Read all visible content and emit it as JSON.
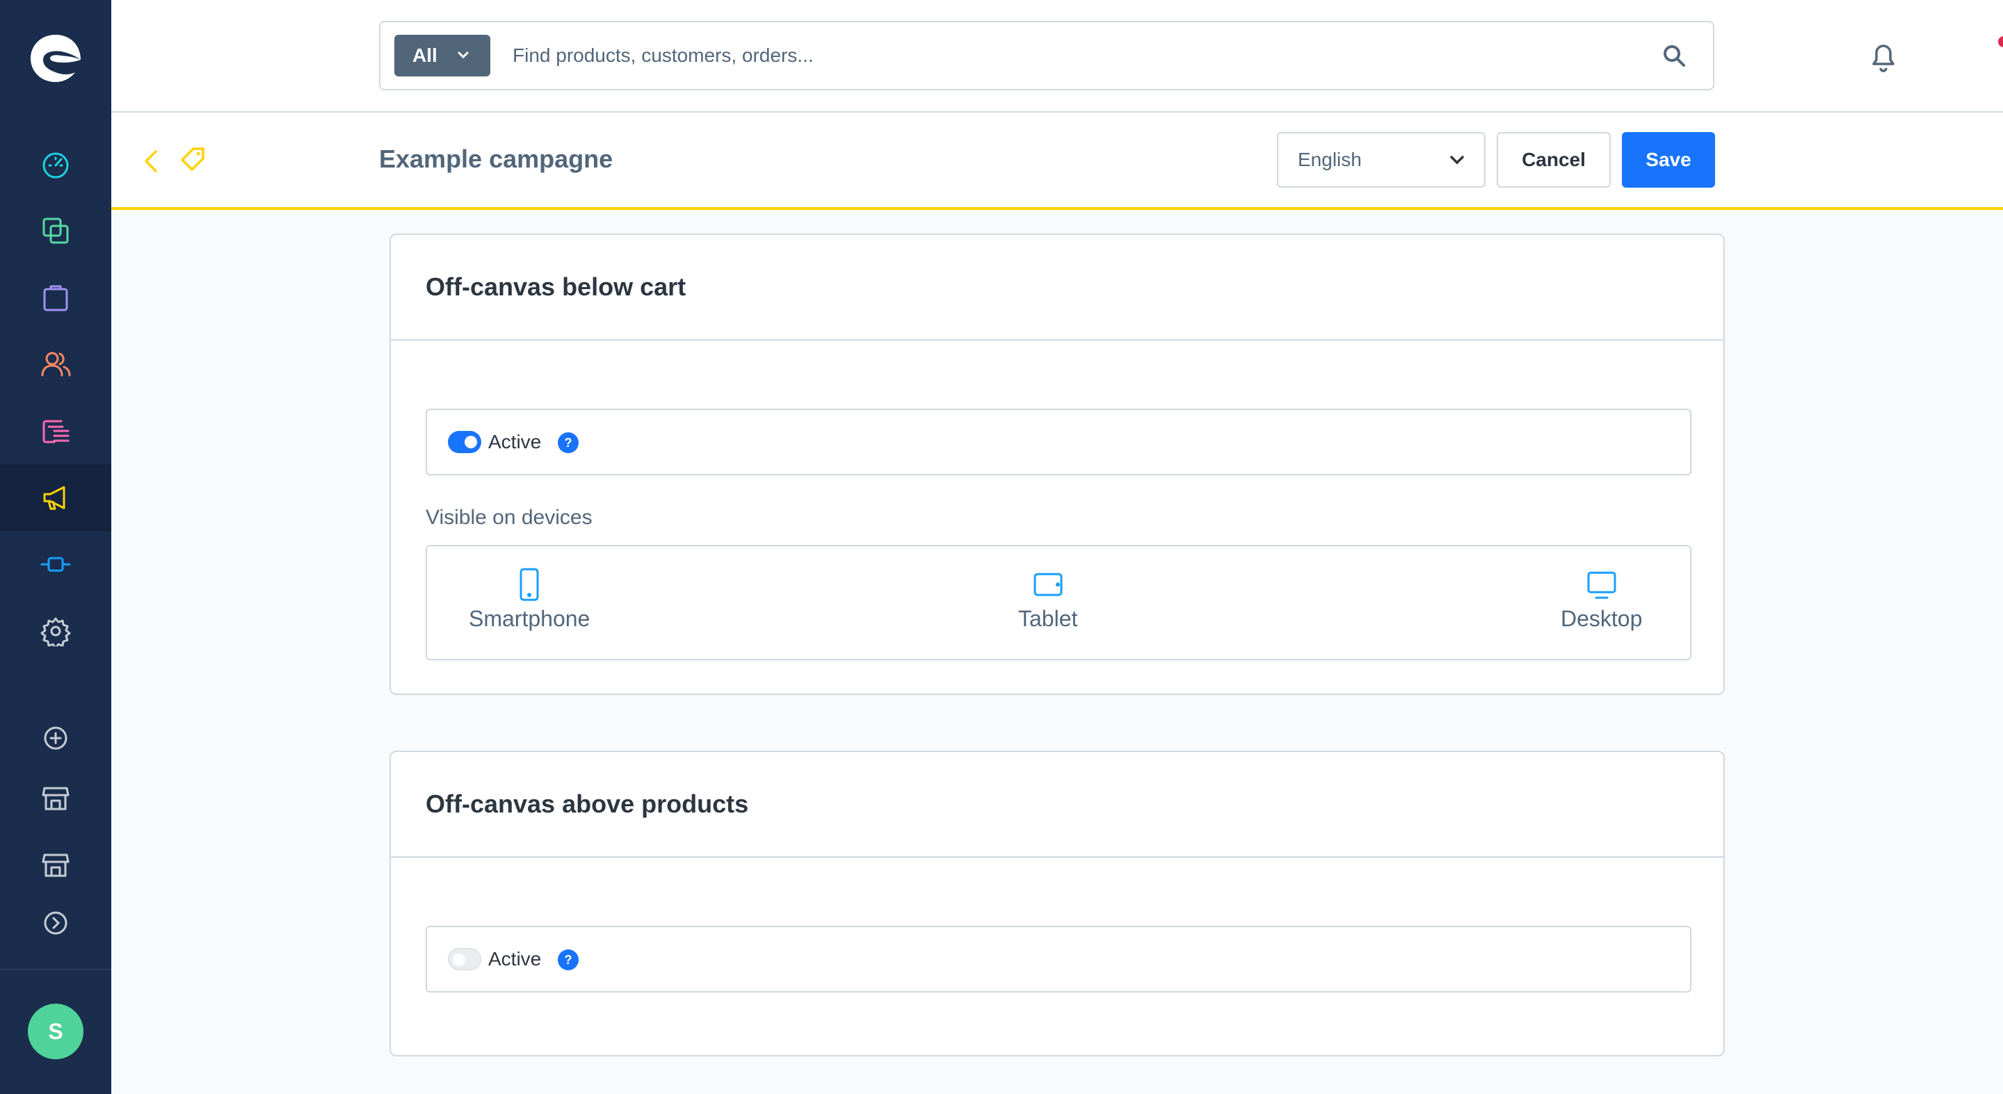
{
  "header": {
    "search": {
      "type_label": "All",
      "placeholder": "Find products, customers, orders..."
    }
  },
  "smartbar": {
    "title": "Example campagne",
    "language": "English",
    "cancel_label": "Cancel",
    "save_label": "Save"
  },
  "user": {
    "initial": "S"
  },
  "sections": [
    {
      "title": "Off-canvas below cart",
      "active": true,
      "active_label": "Active",
      "help_glyph": "?",
      "devices_label": "Visible on devices",
      "devices": [
        "Smartphone",
        "Tablet",
        "Desktop"
      ]
    },
    {
      "title": "Off-canvas above products",
      "active": false,
      "active_label": "Active",
      "help_glyph": "?"
    }
  ],
  "icons": {
    "sidebar": [
      "dashboard-icon",
      "catalog-icon",
      "orders-icon",
      "customers-icon",
      "content-icon",
      "marketing-icon",
      "extensions-icon",
      "settings-icon",
      "add-sales-channel-icon",
      "storefront-icon",
      "storefront-icon",
      "expand-icon"
    ],
    "colors": {
      "dashboard": "#1fd1e0",
      "catalog": "#57d9a3",
      "orders": "#a092f0",
      "customers": "#f88962",
      "content": "#ff68b4",
      "marketing": "#ffd100",
      "extensions": "#189eff",
      "neutral": "#c5cdd6"
    }
  }
}
